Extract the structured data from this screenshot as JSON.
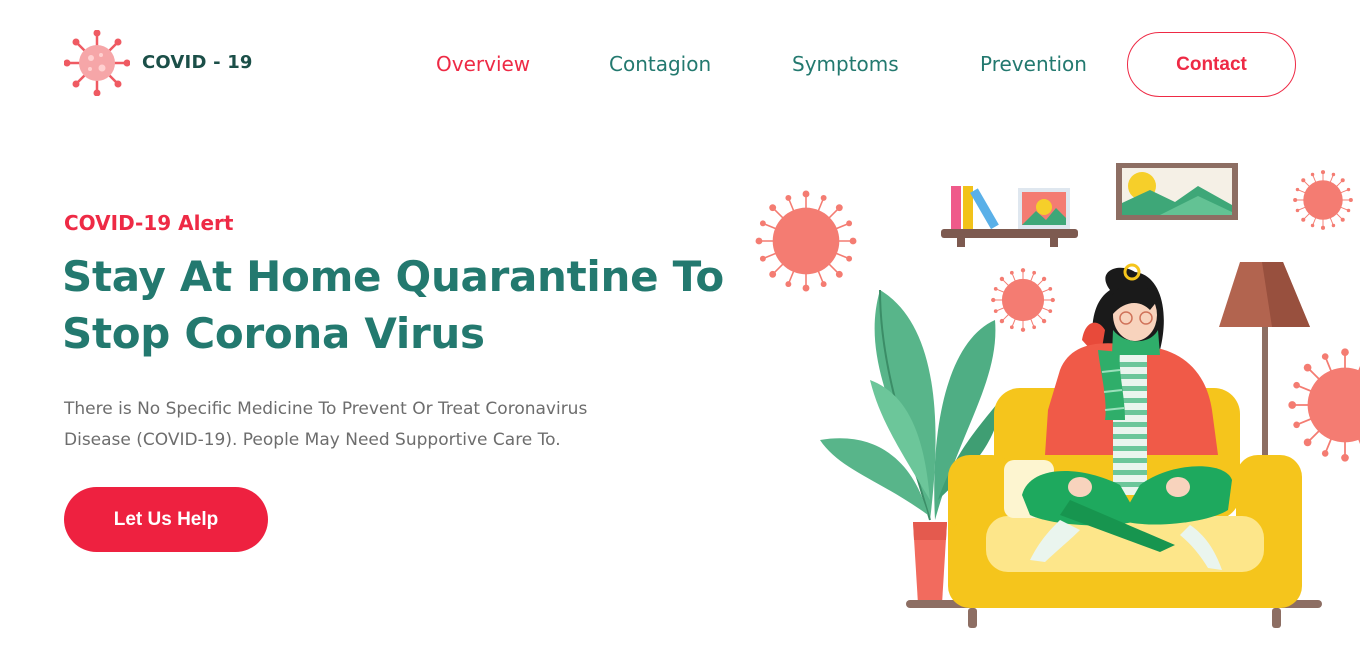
{
  "header": {
    "brand": "COVID - 19",
    "nav": [
      {
        "label": "Overview",
        "active": true
      },
      {
        "label": "Contagion",
        "active": false
      },
      {
        "label": "Symptoms",
        "active": false
      },
      {
        "label": "Prevention",
        "active": false
      }
    ],
    "contact_label": "Contact"
  },
  "hero": {
    "alert": "COVID-19 Alert",
    "title_line1": "Stay At Home Quarantine To",
    "title_line2": "Stop Corona Virus",
    "desc_line1": "There is No Specific Medicine To Prevent Or Treat Coronavirus",
    "desc_line2": "Disease (COVID-19). People May Need Supportive Care To.",
    "cta_label": "Let Us Help"
  },
  "icons": {
    "logo": "virus-icon",
    "illustration": "woman-on-sofa-illustration"
  },
  "colors": {
    "accent": "#ee2a45",
    "brand_teal": "#23796f",
    "brand_dark": "#1b4f48",
    "body_text": "#6d6d6d"
  }
}
